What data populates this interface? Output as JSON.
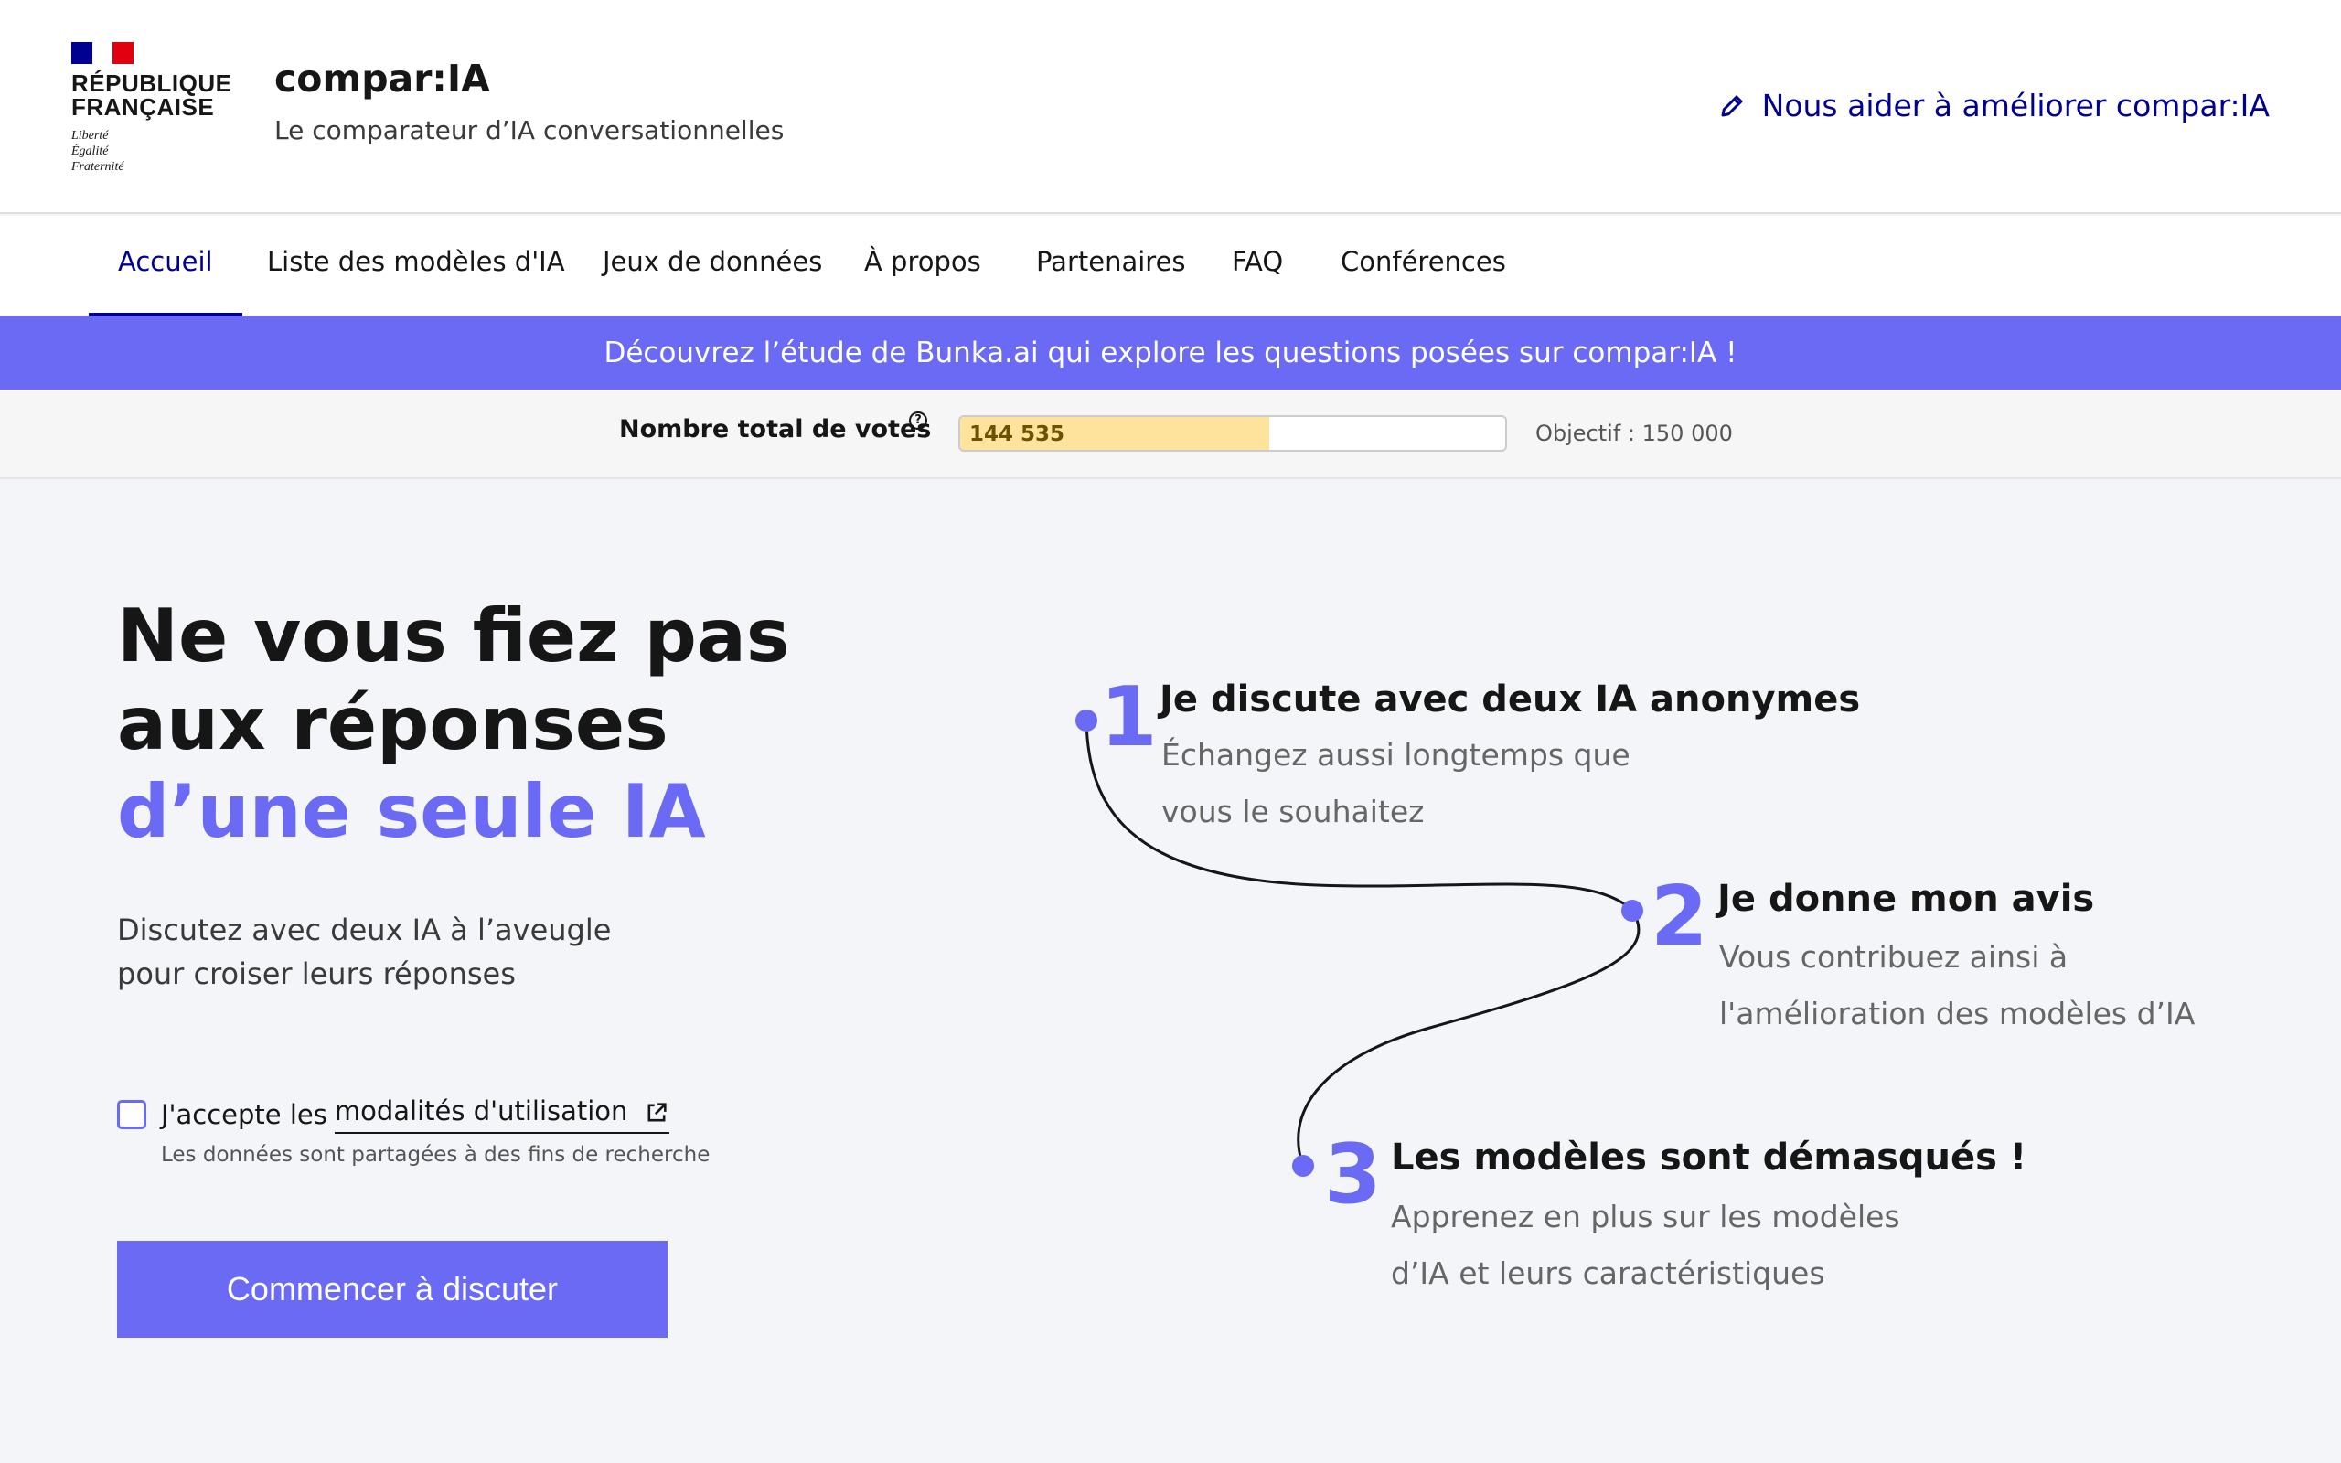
{
  "header": {
    "rf_line1": "RÉPUBLIQUE",
    "rf_line2": "FRANÇAISE",
    "devise_1": "Liberté",
    "devise_2": "Égalité",
    "devise_3": "Fraternité",
    "site_title": "compar:IA",
    "site_subtitle": "Le comparateur d’IA conversationnelles",
    "help_link": "Nous aider à améliorer compar:IA",
    "help_icon": "pencil-icon"
  },
  "nav": {
    "items": [
      {
        "label": "Accueil",
        "active": true
      },
      {
        "label": "Liste des modèles d'IA"
      },
      {
        "label": "Jeux de données"
      },
      {
        "label": "À propos"
      },
      {
        "label": "Partenaires"
      },
      {
        "label": "FAQ"
      },
      {
        "label": "Conférences"
      }
    ]
  },
  "banner": {
    "text": "Découvrez l’étude de Bunka.ai qui explore les questions posées sur compar:IA !"
  },
  "votes": {
    "label": "Nombre total de votes",
    "help_icon": "?",
    "value_text": "144 535",
    "value": 144535,
    "objective_text": "Objectif : 150 000",
    "objective": 150000
  },
  "hero": {
    "title_line1": "Ne vous fiez pas",
    "title_line2": "aux réponses",
    "title_line3": "d’une seule IA",
    "desc_line1": "Discutez avec deux IA à l’aveugle",
    "desc_line2": "pour croiser leurs réponses",
    "terms_prefix": "J'accepte les",
    "terms_link": "modalités d'utilisation",
    "terms_note": "Les données sont partagées à des fins de recherche",
    "cta": "Commencer à discuter"
  },
  "steps": [
    {
      "num": "1",
      "title": "Je discute avec deux IA anonymes",
      "desc_line1": "Échangez aussi longtemps que",
      "desc_line2": "vous le souhaitez"
    },
    {
      "num": "2",
      "title": "Je donne mon avis",
      "desc_line1": "Vous contribuez ainsi à",
      "desc_line2": "l'amélioration des modèles d’IA"
    },
    {
      "num": "3",
      "title": "Les modèles sont démasqués !",
      "desc_line1": "Apprenez en plus sur les modèles",
      "desc_line2": "d’IA et leurs caractéristiques"
    }
  ],
  "colors": {
    "accent": "#6a6af4",
    "brand_blue": "#000091",
    "progress_fill": "#fde39c"
  }
}
